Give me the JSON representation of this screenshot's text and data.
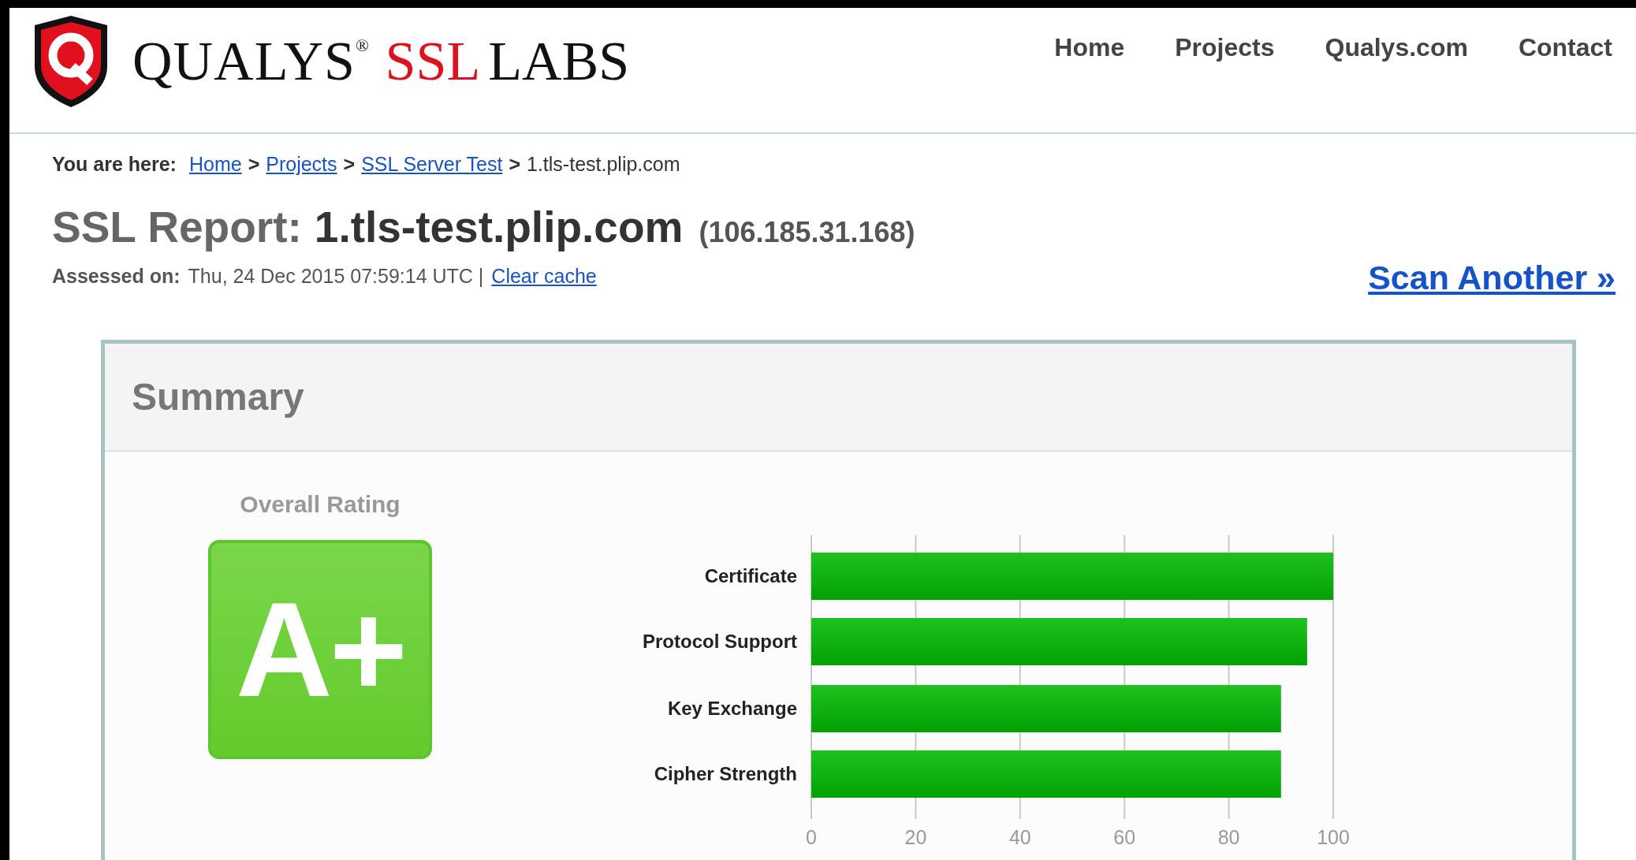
{
  "logo": {
    "brand": "QUALYS$^{®}$",
    "product_1": "SSL",
    "product_2": "LABS"
  },
  "nav": [
    "Home",
    "Projects",
    "Qualys.com",
    "Contact"
  ],
  "breadcrumb": {
    "label": "You are here:",
    "links": [
      "Home",
      "Projects",
      "SSL Server Test"
    ],
    "separator": ">",
    "current": "1.tls-test.plip.com"
  },
  "report": {
    "title_prefix": "SSL Report:",
    "host": "1.tls-test.plip.com",
    "ip": "(106.185.31.168)",
    "assessed_label": "Assessed on:",
    "assessed_value": "Thu, 24 Dec 2015 07:59:14 UTC |",
    "clear_cache": "Clear cache",
    "scan_another": "Scan Another »"
  },
  "summary": {
    "title": "Summary",
    "rating_label": "Overall Rating",
    "grade": "A+",
    "chart_data": {
      "type": "bar",
      "orientation": "horizontal",
      "categories": [
        "Certificate",
        "Protocol Support",
        "Key Exchange",
        "Cipher Strength"
      ],
      "series": [
        {
          "color": "#1ec21e",
          "values": [
            100,
            95,
            90,
            90
          ]
        }
      ],
      "xlim": [
        0,
        100
      ],
      "xticks": [
        0,
        20,
        40,
        60,
        80,
        100
      ],
      "grid": true
    }
  }
}
